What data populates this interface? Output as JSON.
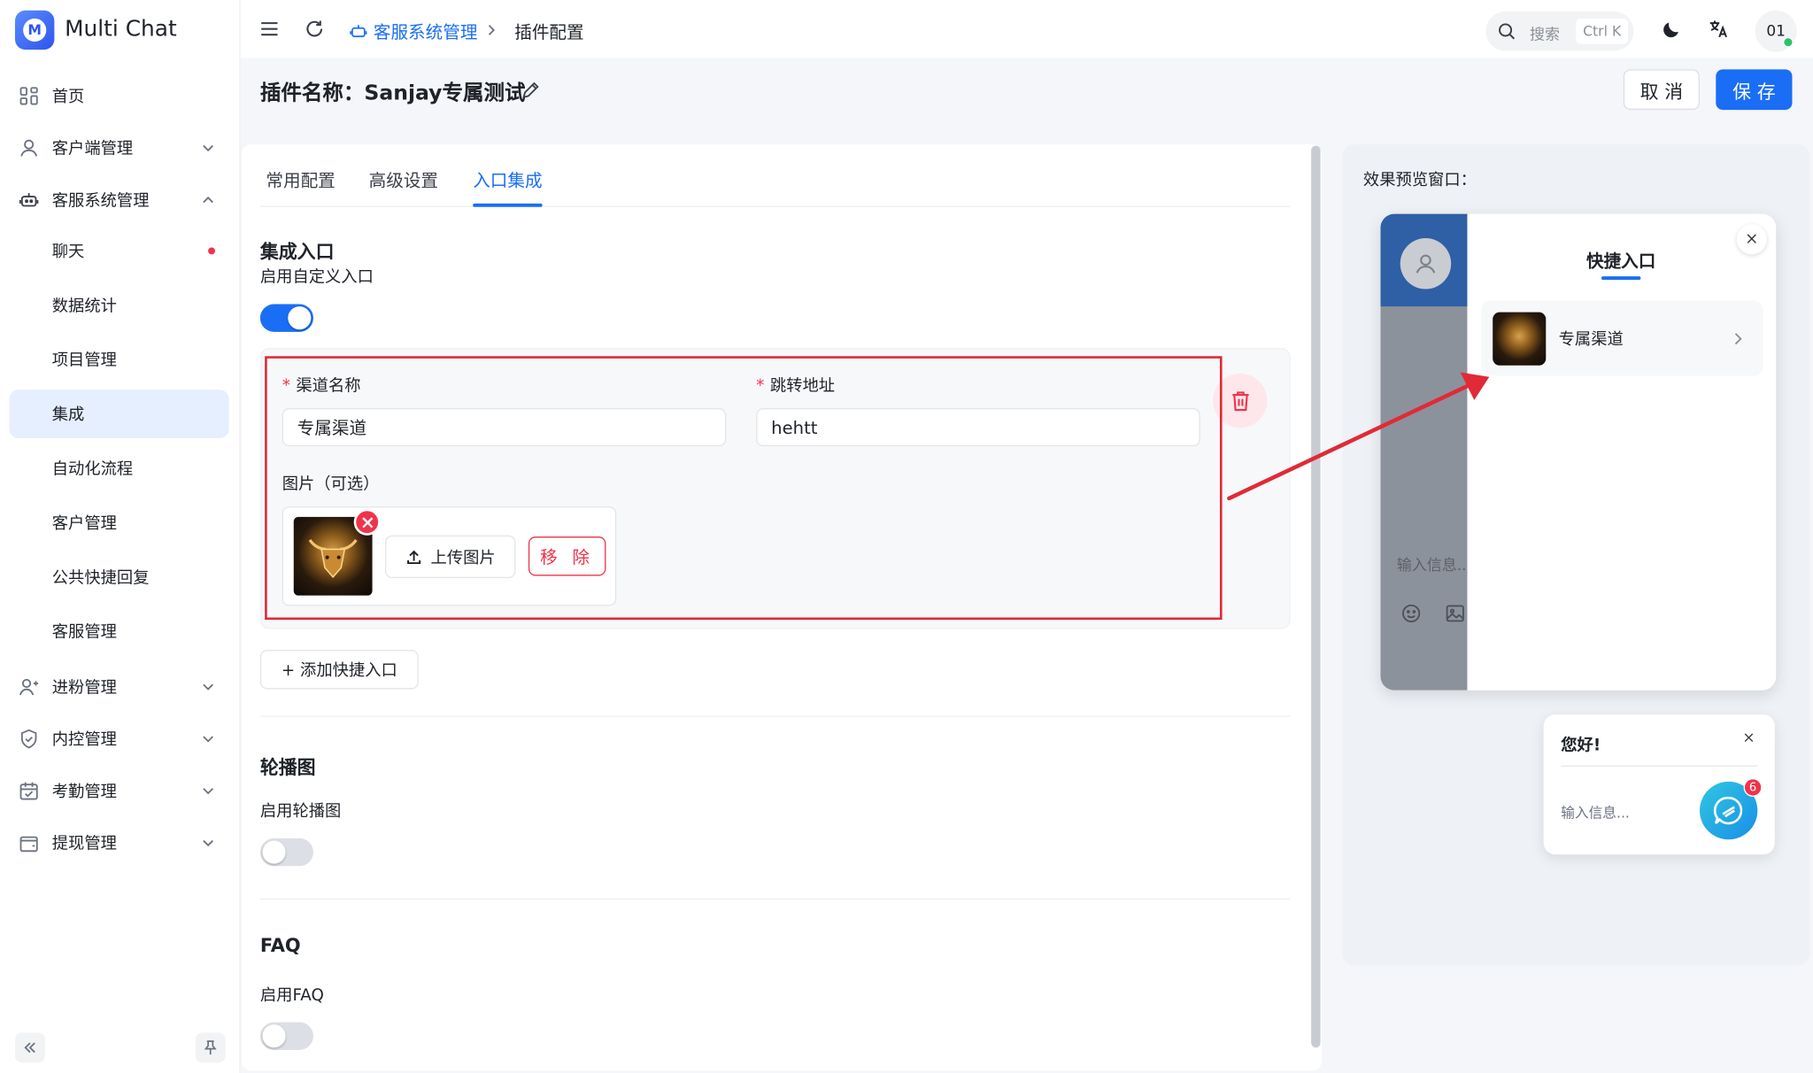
{
  "app": {
    "name": "Multi Chat",
    "logo_letter": "M"
  },
  "sidebar": {
    "items": [
      {
        "label": "首页"
      },
      {
        "label": "客户端管理"
      },
      {
        "label": "客服系统管理"
      },
      {
        "label": "聊天"
      },
      {
        "label": "数据统计"
      },
      {
        "label": "项目管理"
      },
      {
        "label": "集成"
      },
      {
        "label": "自动化流程"
      },
      {
        "label": "客户管理"
      },
      {
        "label": "公共快捷回复"
      },
      {
        "label": "客服管理"
      },
      {
        "label": "进粉管理"
      },
      {
        "label": "内控管理"
      },
      {
        "label": "考勤管理"
      },
      {
        "label": "提现管理"
      }
    ]
  },
  "header": {
    "breadcrumb": [
      "客服系统管理",
      "插件配置"
    ],
    "search_placeholder": "搜索",
    "search_shortcut": "Ctrl K",
    "avatar_text": "01"
  },
  "page": {
    "title": "插件名称：Sanjay专属测试",
    "cancel_label": "取 消",
    "save_label": "保 存"
  },
  "tabs": [
    "常用配置",
    "高级设置",
    "入口集成"
  ],
  "integration": {
    "section_title": "集成入口",
    "enable_label": "启用自定义入口",
    "enabled": true,
    "channel_name_label": "渠道名称",
    "channel_name_value": "专属渠道",
    "url_label": "跳转地址",
    "url_value": "hehtt",
    "image_label": "图片（可选）",
    "upload_label": "上传图片",
    "remove_label": "移 除",
    "add_label": "+ 添加快捷入口"
  },
  "carousel": {
    "section_title": "轮播图",
    "enable_label": "启用轮播图",
    "enabled": false
  },
  "faq": {
    "section_title": "FAQ",
    "enable_label": "启用FAQ",
    "enabled": false
  },
  "preview": {
    "label": "效果预览窗口：",
    "quick_title": "快捷入口",
    "channel_item": "专属渠道",
    "input_placeholder": "输入信息...",
    "greeting": "您好!",
    "chat_placeholder": "输入信息...",
    "badge_count": "6",
    "close_symbol": "×"
  },
  "colors": {
    "primary": "#1a6ef5",
    "danger": "#f0334a",
    "highlight": "#e02a38"
  }
}
